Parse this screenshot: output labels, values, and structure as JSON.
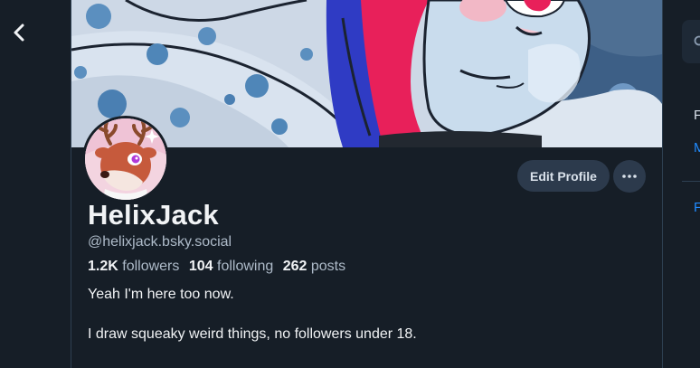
{
  "nav": {
    "back_icon": "chevron-left-icon"
  },
  "profile": {
    "display_name": "HelixJack",
    "handle": "@helixjack.bsky.social",
    "stats": {
      "followers_count": "1.2K",
      "followers_label": "followers",
      "following_count": "104",
      "following_label": "following",
      "posts_count": "262",
      "posts_label": "posts"
    },
    "bio": [
      "Yeah I'm here too now.",
      "I draw squeaky weird things, no followers under 18."
    ]
  },
  "actions": {
    "edit_profile_label": "Edit Profile",
    "more_icon": "ellipsis-icon"
  },
  "right_panel": {
    "line1": "F",
    "line2": "M",
    "line3": "F"
  },
  "colors": {
    "background": "#161e27",
    "button_bg": "#2c3a4c",
    "accent": "#208bfe",
    "muted_text": "#aebbc9"
  }
}
